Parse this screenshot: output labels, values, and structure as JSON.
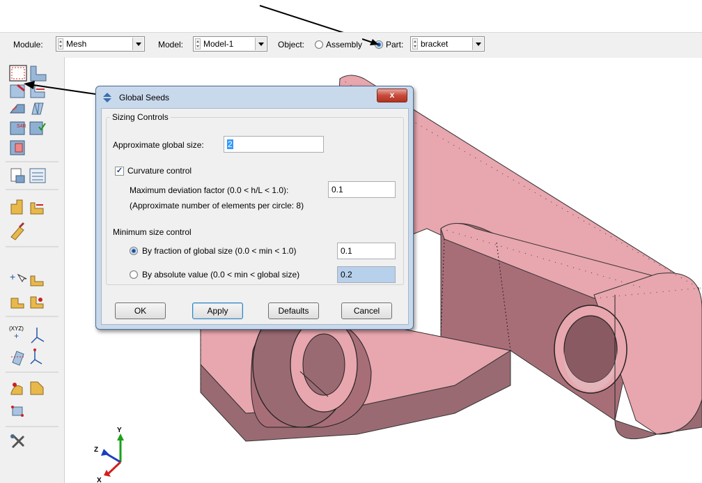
{
  "context_bar": {
    "module_label": "Module:",
    "module_value": "Mesh",
    "model_label": "Model:",
    "model_value": "Model-1",
    "object_label": "Object:",
    "assembly_label": "Assembly",
    "part_label": "Part:",
    "part_value": "bracket",
    "selected_object": "Part"
  },
  "dialog": {
    "title": "Global Seeds",
    "close_label": "x",
    "sizing_group_label": "Sizing Controls",
    "global_size_label": "Approximate global size:",
    "global_size_value": "2",
    "curvature_label": "Curvature control",
    "curvature_checked": true,
    "deviation_label": "Maximum deviation factor (0.0 < h/L < 1.0):",
    "deviation_value": "0.1",
    "elements_note": "(Approximate number of elements per circle: 8)",
    "min_size_label": "Minimum size control",
    "fraction_label": "By fraction of global size  (0.0 < min < 1.0)",
    "fraction_value": "0.1",
    "absolute_label": "By absolute value  (0.0 < min < global size)",
    "absolute_value": "0.2",
    "selected_min_option": "fraction",
    "buttons": {
      "ok": "OK",
      "apply": "Apply",
      "defaults": "Defaults",
      "cancel": "Cancel"
    }
  },
  "triad": {
    "z": "Z",
    "y": "Y",
    "x": "X"
  },
  "colors": {
    "part": "#e8a6ae",
    "part_dark": "#9a6a72",
    "toolbar": "#f0f0f0",
    "dialog_frame": "#c9d9ec",
    "selected_field": "#b7d0ec"
  },
  "icons": [
    "seed-part-icon",
    "seed-edge-icon",
    "mesh-controls-icon",
    "element-type-icon",
    "mesh-part-icon",
    "mesh-region-icon",
    "assign-element-icon",
    "verify-mesh-icon",
    "create-virtual-topology-icon",
    "query-icon",
    "report-icon",
    "partition-icon",
    "partition-face-icon",
    "edit-mesh-icon",
    "datum-point-icon",
    "datum-axis-icon",
    "datum-plane-icon",
    "datum-csys-icon",
    "xyz-point-icon",
    "tripod-icon",
    "edge-datum-icon",
    "csys-icon",
    "sweep-icon",
    "boolean-icon",
    "transform-icon",
    "tools-icon"
  ]
}
